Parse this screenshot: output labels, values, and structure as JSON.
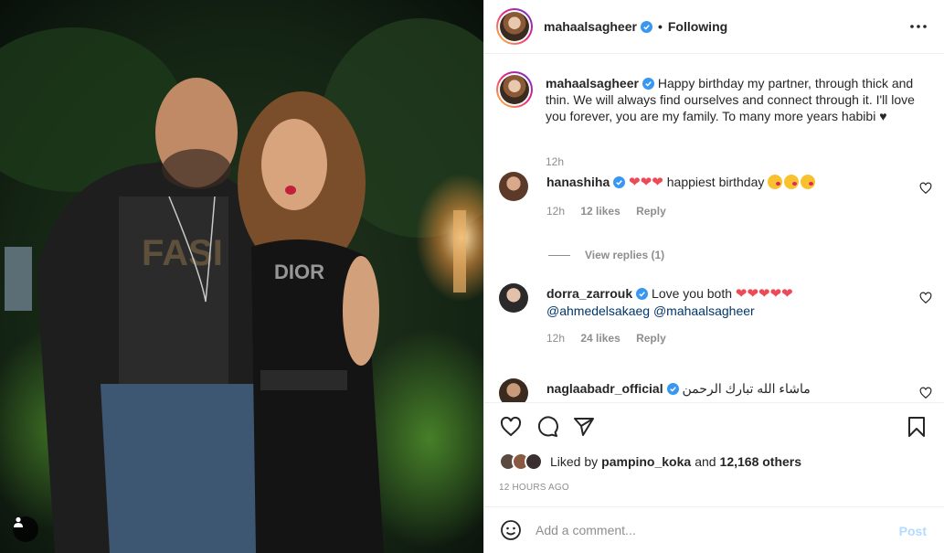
{
  "post_image": {
    "alt": ""
  },
  "header": {
    "username": "mahaalsagheer",
    "dot": "•",
    "follow_status": "Following"
  },
  "caption": {
    "username": "mahaalsagheer",
    "text": "Happy birthday my partner, through thick and thin. We will always find ourselves and connect through it. I'll love you forever, you are my family. To many more years habibi ♥",
    "time": "12h"
  },
  "comments": [
    {
      "username": "hanashiha",
      "hearts": "❤❤❤",
      "text": "happiest birthday",
      "time": "12h",
      "likes": "12 likes",
      "reply": "Reply"
    },
    {
      "username": "dorra_zarrouk",
      "text": "Love you both",
      "hearts": "❤❤❤❤❤",
      "mention1": "@ahmedelsakaeg",
      "mention2": "@mahaalsagheer",
      "time": "12h",
      "likes": "24 likes",
      "reply": "Reply"
    },
    {
      "username": "naglaabadr_official",
      "text": "ماشاء الله تبارك الرحمن"
    }
  ],
  "view_replies": "View replies (1)",
  "likes": {
    "prefix": "Liked by",
    "user": "pampino_koka",
    "and": "and",
    "others": "12,168 others"
  },
  "time_ago": "12 HOURS AGO",
  "add_comment": {
    "placeholder": "Add a comment...",
    "post_label": "Post"
  },
  "colors": {
    "verified": "#3897f0",
    "like_red": "#ed4956",
    "post_disabled": "#b3dbff"
  }
}
